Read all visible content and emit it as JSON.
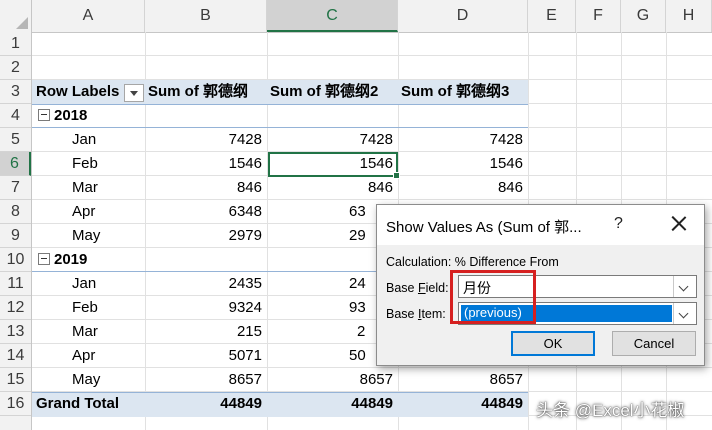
{
  "columns": [
    "A",
    "B",
    "C",
    "D",
    "E",
    "F",
    "G",
    "H"
  ],
  "selected_column": "C",
  "rows": [
    "1",
    "2",
    "3",
    "4",
    "5",
    "6",
    "7",
    "8",
    "9",
    "10",
    "11",
    "12",
    "13",
    "14",
    "15",
    "16"
  ],
  "selected_row": "6",
  "pivot": {
    "header": {
      "row_labels": "Row Labels",
      "col_b": "Sum of 郭德纲",
      "col_c": "Sum of 郭德纲2",
      "col_d": "Sum of 郭德纲3"
    },
    "year_2018": "2018",
    "rows_2018": [
      {
        "m": "Jan",
        "b": "7428",
        "c": "7428",
        "d": "7428"
      },
      {
        "m": "Feb",
        "b": "1546",
        "c": "1546",
        "d": "1546"
      },
      {
        "m": "Mar",
        "b": "846",
        "c": "846",
        "d": "846"
      },
      {
        "m": "Apr",
        "b": "6348",
        "c": "63"
      },
      {
        "m": "May",
        "b": "2979",
        "c": "29"
      }
    ],
    "year_2019": "2019",
    "rows_2019": [
      {
        "m": "Jan",
        "b": "2435",
        "c": "24"
      },
      {
        "m": "Feb",
        "b": "9324",
        "c": "93"
      },
      {
        "m": "Mar",
        "b": "215",
        "c": "2"
      },
      {
        "m": "Apr",
        "b": "5071",
        "c": "50"
      },
      {
        "m": "May",
        "b": "8657",
        "c": "8657",
        "d": "8657"
      }
    ],
    "total": {
      "label": "Grand Total",
      "b": "44849",
      "c": "44849",
      "d": "44849"
    }
  },
  "dialog": {
    "title": "Show Values As (Sum of 郭...",
    "help": "?",
    "calculation": "Calculation: % Difference From",
    "base_field_label_pre": "Base ",
    "base_field_label_key": "F",
    "base_field_label_post": "ield:",
    "base_field_value": "月份",
    "base_item_label_pre": "Base ",
    "base_item_label_key": "I",
    "base_item_label_post": "tem:",
    "base_item_value": "(previous)",
    "ok": "OK",
    "cancel": "Cancel"
  },
  "watermark": "头条 @Excel小花椒",
  "colors": {
    "accent": "#217346",
    "pivot_header": "#dce6f1",
    "highlight": "#d62020",
    "selection": "#0078d7"
  }
}
